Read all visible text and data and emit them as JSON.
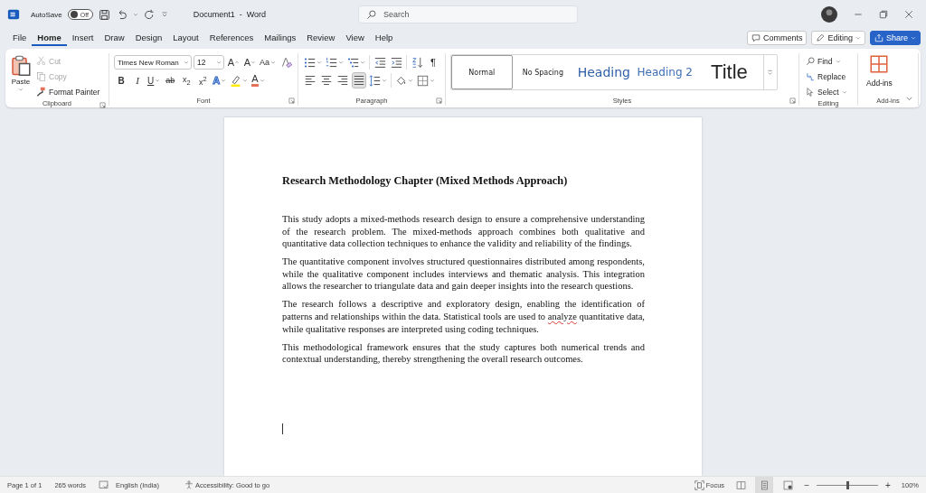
{
  "title_bar": {
    "autosave_label": "AutoSave",
    "autosave": {
      "label": "Off",
      "on": false
    },
    "document_title": "Document1  -  Word",
    "search": {
      "placeholder": "Search"
    }
  },
  "menu_tabs": [
    {
      "label": "File",
      "selected": false
    },
    {
      "label": "Home",
      "selected": true
    },
    {
      "label": "Insert",
      "selected": false
    },
    {
      "label": "Draw",
      "selected": false
    },
    {
      "label": "Design",
      "selected": false
    },
    {
      "label": "Layout",
      "selected": false
    },
    {
      "label": "References",
      "selected": false
    },
    {
      "label": "Mailings",
      "selected": false
    },
    {
      "label": "Review",
      "selected": false
    },
    {
      "label": "View",
      "selected": false
    },
    {
      "label": "Help",
      "selected": false
    }
  ],
  "action_buttons": {
    "comments": "Comments",
    "editing": "Editing",
    "share": "Share"
  },
  "ribbon": {
    "clipboard": {
      "paste": "Paste",
      "cut": {
        "label": "Cut",
        "disabled": true
      },
      "copy": {
        "label": "Copy",
        "disabled": true
      },
      "format_painter": "Format Painter",
      "label": "Clipboard"
    },
    "font": {
      "font_name": "Times New Roman",
      "font_size": "12",
      "row1": [
        {
          "glyph": "A",
          "kind": "grow"
        },
        {
          "glyph": "A",
          "kind": "shrink"
        },
        {
          "glyph": "Aa",
          "kind": "case"
        },
        {
          "kind": "clear"
        }
      ],
      "row2": [
        {
          "glyph": "B",
          "kind": "bold"
        },
        {
          "glyph": "I",
          "kind": "italic"
        },
        {
          "glyph": "U",
          "kind": "underline"
        },
        {
          "glyph": "ab",
          "kind": "strike"
        },
        {
          "glyph": "x$_{2}$",
          "kind": "subscript"
        },
        {
          "glyph": "x$^{2}$",
          "kind": "superscript"
        },
        {
          "glyph": "A",
          "kind": "effects"
        },
        {
          "kind": "highlight"
        },
        {
          "glyph": "A",
          "kind": "color"
        }
      ],
      "label": "Font"
    },
    "paragraph": {
      "show_marks_glyph": "¶",
      "alignment": [
        {
          "kind": "left",
          "selected": false
        },
        {
          "kind": "center",
          "selected": false
        },
        {
          "kind": "right",
          "selected": false
        },
        {
          "kind": "justify",
          "selected": true
        }
      ],
      "label": "Paragraph"
    },
    "styles": {
      "items": [
        {
          "label": "Normal",
          "kind": "normal",
          "selected": true
        },
        {
          "label": "No Spacing",
          "kind": "nospacing",
          "selected": false
        },
        {
          "label": "Heading",
          "kind": "heading1",
          "selected": false
        },
        {
          "label": "Heading 2",
          "kind": "heading2",
          "selected": false
        },
        {
          "label": "Title",
          "kind": "title",
          "selected": false
        }
      ],
      "label": "Styles"
    },
    "editing": {
      "find": "Find",
      "replace": "Replace",
      "select": "Select",
      "label": "Editing"
    },
    "addins": {
      "button": "Add-ins",
      "label": "Add-ins"
    }
  },
  "document": {
    "heading": "Research Methodology Chapter (Mixed Methods Approach)",
    "paragraphs": [
      {
        "segments": [
          {
            "text": "This study adopts a mixed-methods research design to ensure a comprehensive understanding of the research problem. The mixed-methods approach combines both qualitative and quantitative data collection techniques to enhance the validity and reliability of the findings.",
            "misspelled": false
          }
        ]
      },
      {
        "segments": [
          {
            "text": "The quantitative component involves structured questionnaires distributed among respondents, while the qualitative component includes interviews and thematic analysis. This integration allows the researcher to triangulate data and gain deeper insights into the research questions.",
            "misspelled": false
          }
        ]
      },
      {
        "segments": [
          {
            "text": "The research follows a descriptive and exploratory design, enabling the identification of patterns and relationships within the data. Statistical tools are used to ",
            "misspelled": false
          },
          {
            "text": "analyze",
            "misspelled": true
          },
          {
            "text": " quantitative data, while qualitative responses are interpreted using coding techniques.",
            "misspelled": false
          }
        ]
      },
      {
        "segments": [
          {
            "text": "This methodological framework ensures that the study captures both numerical trends and contextual understanding, thereby strengthening the overall research outcomes.",
            "misspelled": false
          }
        ]
      }
    ]
  },
  "status_bar": {
    "page": "Page 1 of 1",
    "words": "265 words",
    "language": "English (India)",
    "accessibility": "Accessibility: Good to go",
    "focus": "Focus",
    "views": [
      {
        "kind": "read",
        "selected": false
      },
      {
        "kind": "print",
        "selected": true
      },
      {
        "kind": "web",
        "selected": false
      }
    ],
    "zoom": {
      "minus": "−",
      "plus": "+",
      "level": 0.5,
      "reading": "100%"
    }
  }
}
